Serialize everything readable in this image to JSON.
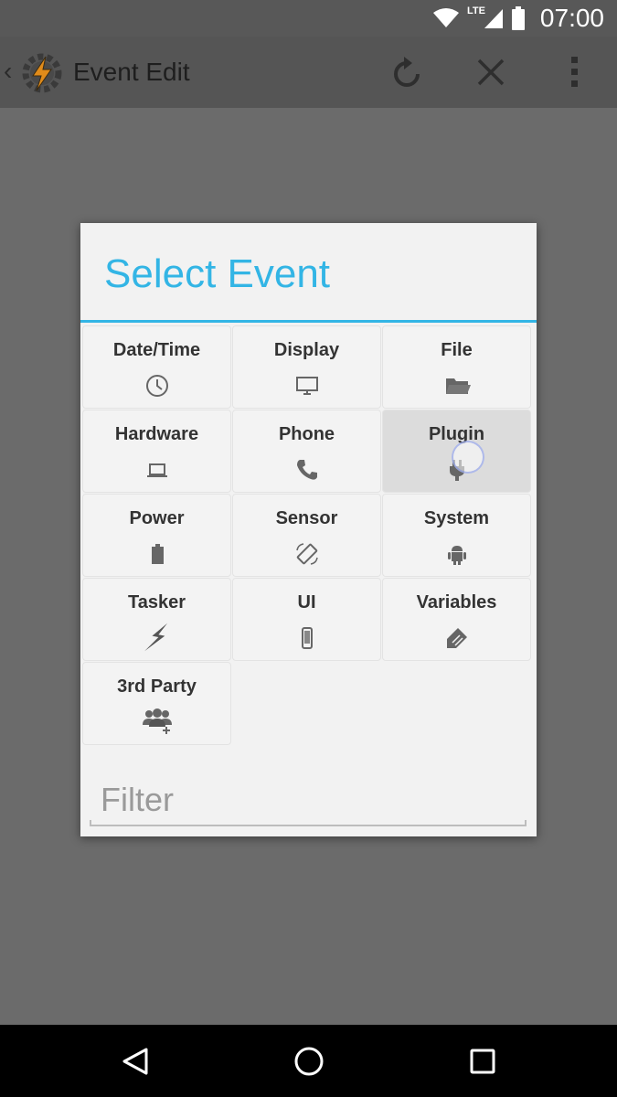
{
  "status_bar": {
    "time": "07:00",
    "network_label": "LTE",
    "icons": [
      "wifi-icon",
      "signal-icon",
      "battery-icon"
    ]
  },
  "action_bar": {
    "title": "Event Edit",
    "actions": [
      "refresh-icon",
      "close-icon",
      "more-vert-icon"
    ]
  },
  "dialog": {
    "title": "Select Event",
    "accent_color": "#33b5e5",
    "categories": [
      {
        "label": "Date/Time",
        "icon": "clock-icon"
      },
      {
        "label": "Display",
        "icon": "monitor-icon"
      },
      {
        "label": "File",
        "icon": "folder-icon"
      },
      {
        "label": "Hardware",
        "icon": "laptop-icon"
      },
      {
        "label": "Phone",
        "icon": "phone-icon"
      },
      {
        "label": "Plugin",
        "icon": "plug-icon",
        "pressed": true
      },
      {
        "label": "Power",
        "icon": "battery-icon"
      },
      {
        "label": "Sensor",
        "icon": "screen-rotation-icon"
      },
      {
        "label": "System",
        "icon": "android-icon"
      },
      {
        "label": "Tasker",
        "icon": "lightning-icon"
      },
      {
        "label": "UI",
        "icon": "smartphone-icon"
      },
      {
        "label": "Variables",
        "icon": "tag-icon"
      },
      {
        "label": "3rd Party",
        "icon": "add-group-icon"
      }
    ],
    "filter_placeholder": "Filter"
  },
  "nav_bar": {
    "buttons": [
      "back-icon",
      "home-icon",
      "recents-icon"
    ]
  }
}
